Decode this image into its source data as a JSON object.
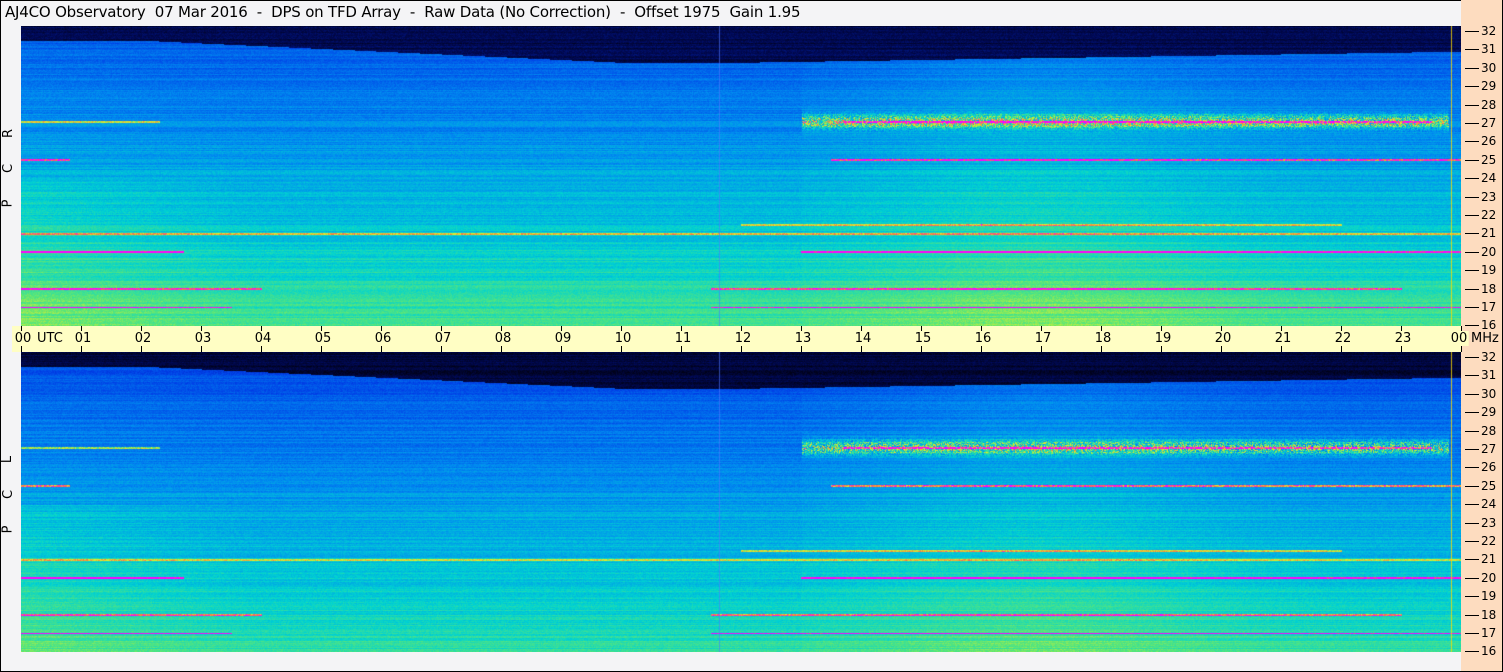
{
  "title": "AJ4CO Observatory  07 Mar 2016  -  DPS on TFD Array  -  Raw Data (No Correction)  -  Offset 1975  Gain 1.95",
  "panels": [
    {
      "label": [
        "R",
        "C",
        "P"
      ]
    },
    {
      "label": [
        "L",
        "C",
        "P"
      ]
    }
  ],
  "time_axis": {
    "unit": "UTC",
    "labels": [
      "00",
      "01",
      "02",
      "03",
      "04",
      "05",
      "06",
      "07",
      "08",
      "09",
      "10",
      "11",
      "12",
      "13",
      "14",
      "15",
      "16",
      "17",
      "18",
      "19",
      "20",
      "21",
      "22",
      "23",
      "00"
    ]
  },
  "freq_axis": {
    "unit": "MHz",
    "labels": [
      "32",
      "31",
      "30",
      "29",
      "28",
      "27",
      "26",
      "25",
      "24",
      "23",
      "22",
      "21",
      "20",
      "19",
      "18",
      "17",
      "16"
    ]
  },
  "colors": {
    "background": "#f4f4f6",
    "axis_band": "#fffec4",
    "right_panel": "#fddcbf"
  },
  "chart_data": {
    "type": "heatmap",
    "title": "AJ4CO Observatory  07 Mar 2016  -  DPS on TFD Array  -  Raw Data (No Correction)  -  Offset 1975  Gain 1.95",
    "xlabel": "UTC",
    "ylabel": "MHz",
    "xlim": [
      0,
      24
    ],
    "ylim": [
      16,
      32
    ],
    "series": [
      {
        "name": "RCP"
      },
      {
        "name": "LCP"
      }
    ],
    "interference_lines_mhz": [
      17,
      18,
      20,
      21,
      21.5,
      25,
      27
    ],
    "enhanced_activity_hours": [
      13.5,
      23.5
    ]
  }
}
